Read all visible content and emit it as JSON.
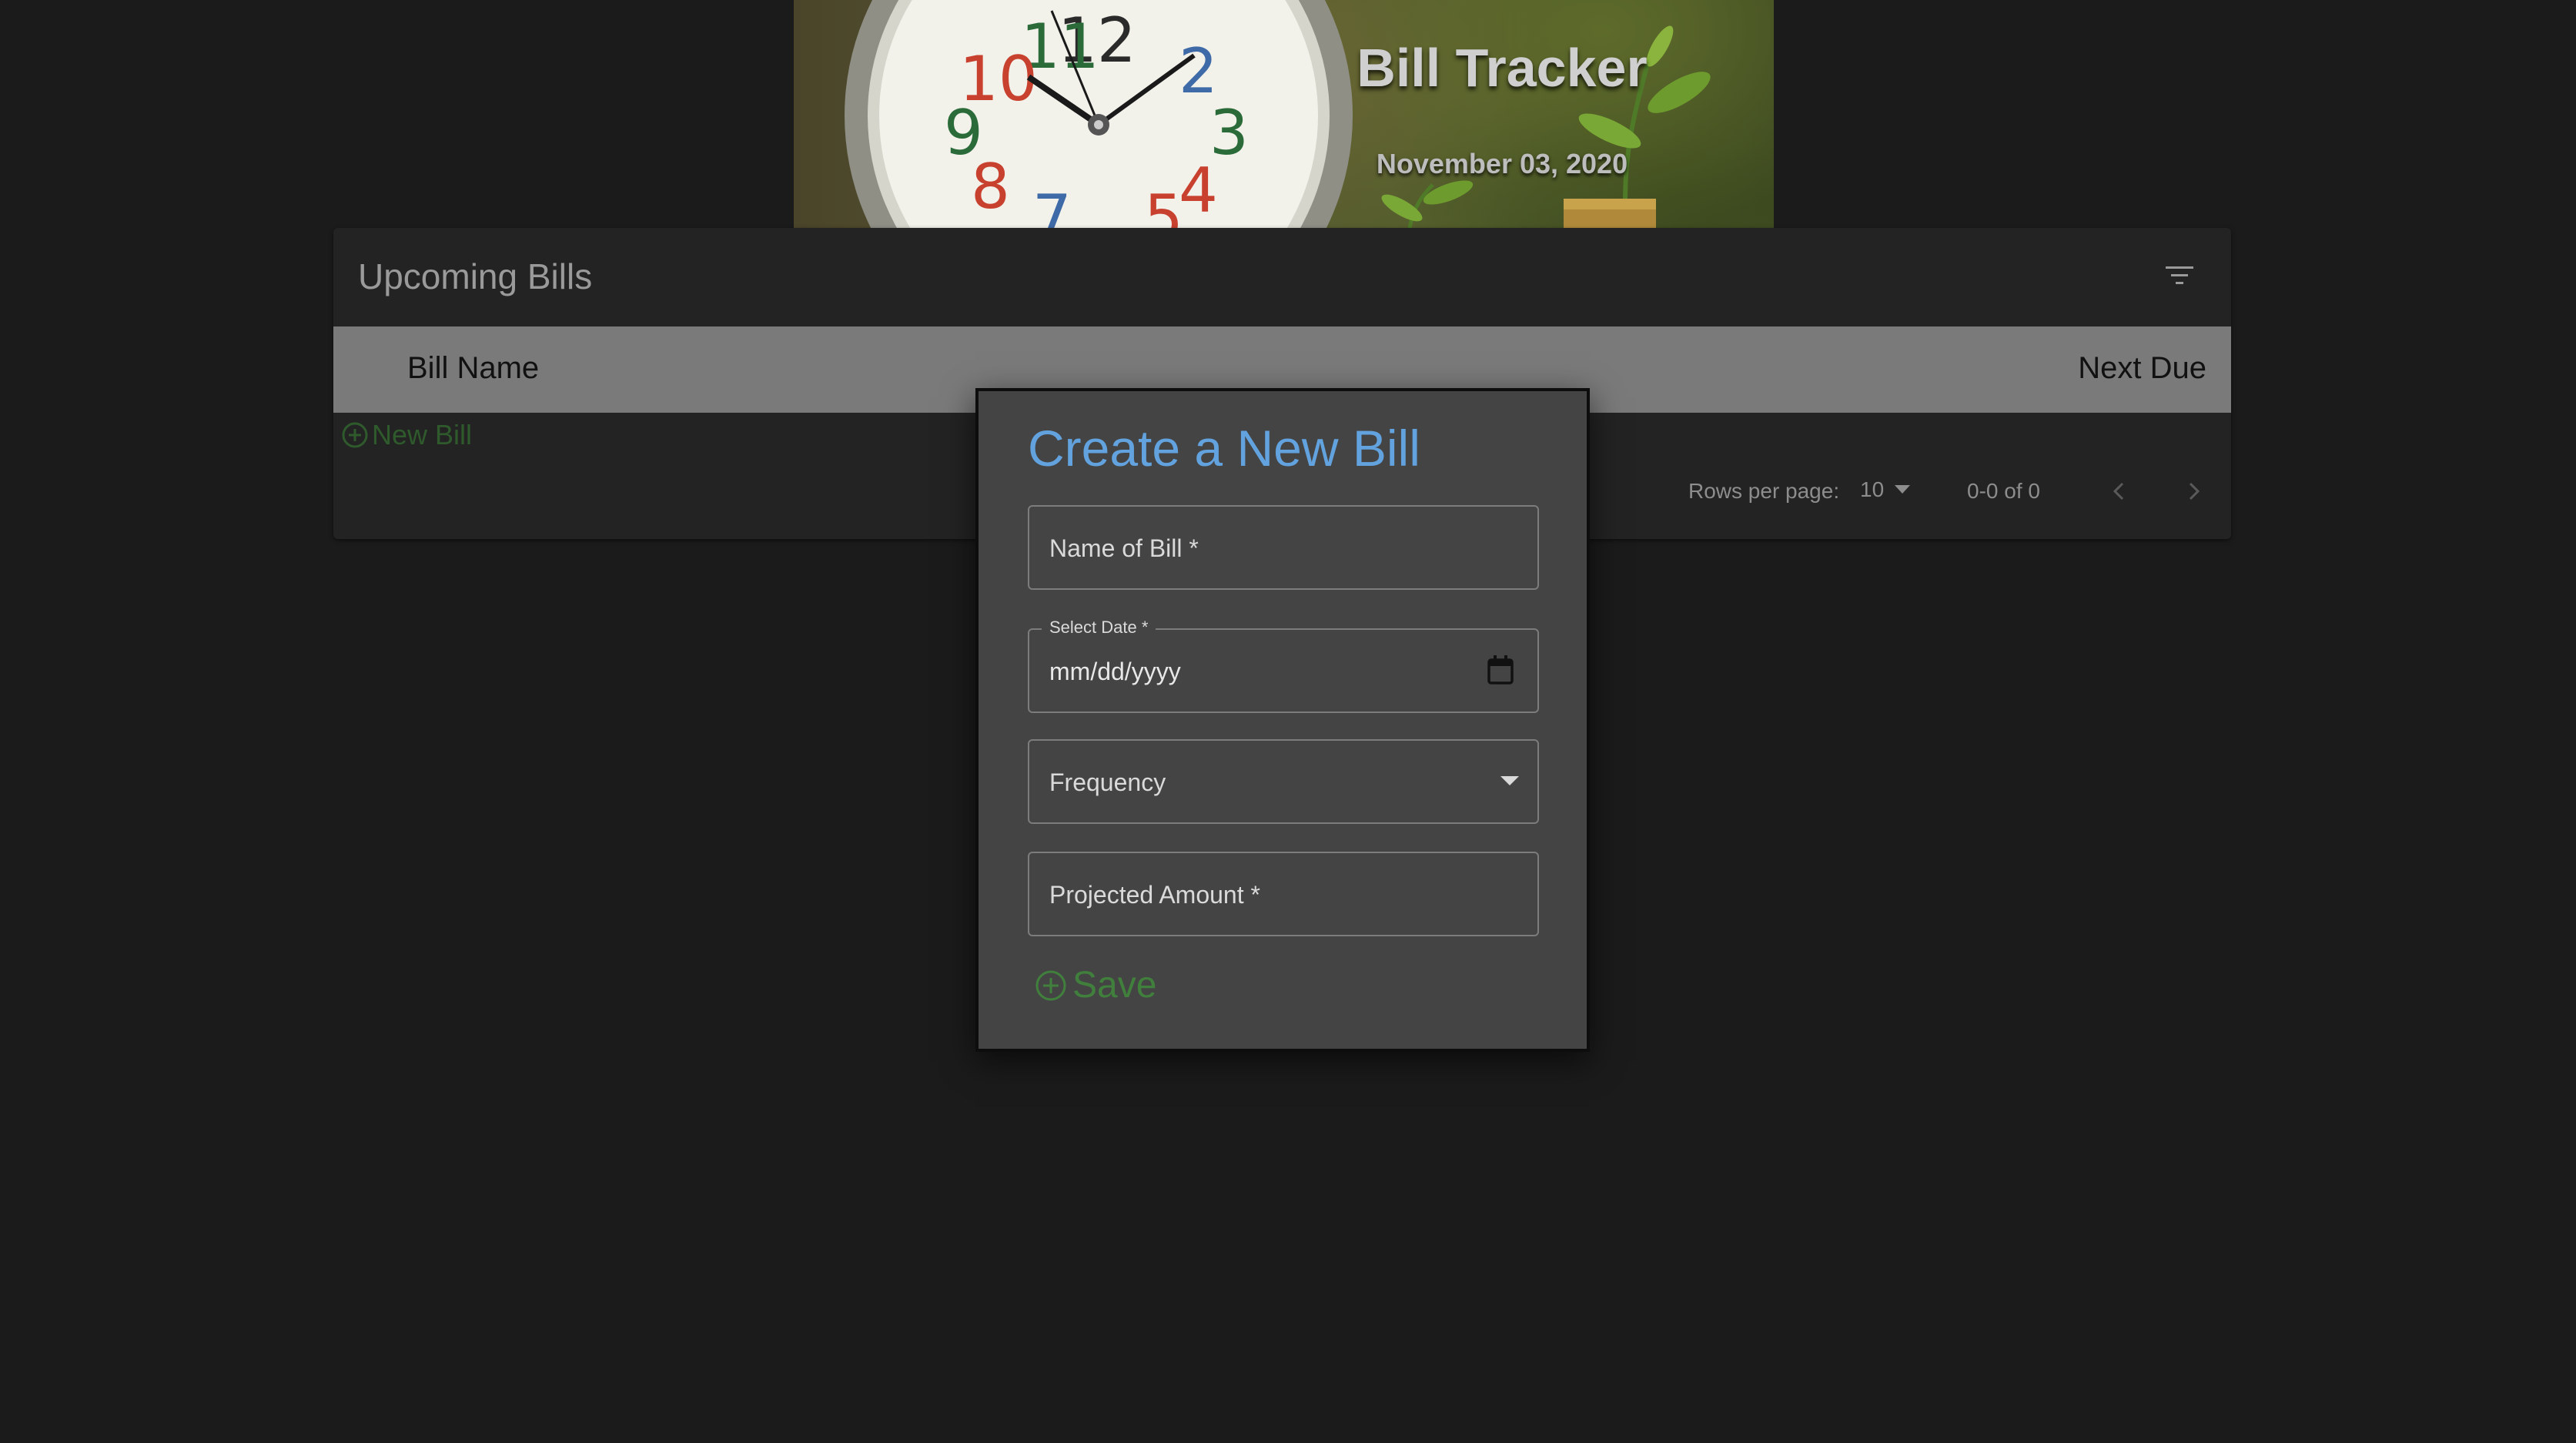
{
  "header": {
    "title": "Bill Tracker",
    "date": "November 03, 2020"
  },
  "bills_table": {
    "title": "Upcoming Bills",
    "columns": [
      "Bill Name",
      "Next Due"
    ],
    "new_bill_label": "New Bill",
    "pagination": {
      "rows_per_page_label": "Rows per page:",
      "rows_per_page_value": "10",
      "range": "0-0 of 0"
    }
  },
  "modal": {
    "title": "Create a New Bill",
    "name_placeholder": "Name of Bill *",
    "date_label": "Select Date *",
    "date_value": "mm/dd/yyyy",
    "frequency_placeholder": "Frequency",
    "amount_placeholder": "Projected Amount *",
    "save_label": "Save"
  },
  "colors": {
    "background": "#1b1b1b",
    "card": "#232323",
    "table_header": "#7a7a7a",
    "modal": "#444444",
    "modal_title": "#62a3df",
    "save": "#40803c",
    "new_bill": "#2e5a2c"
  },
  "icons": [
    "filter-icon",
    "add-circle-icon",
    "calendar-icon",
    "dropdown-arrow-icon",
    "chevron-left-icon",
    "chevron-right-icon"
  ]
}
